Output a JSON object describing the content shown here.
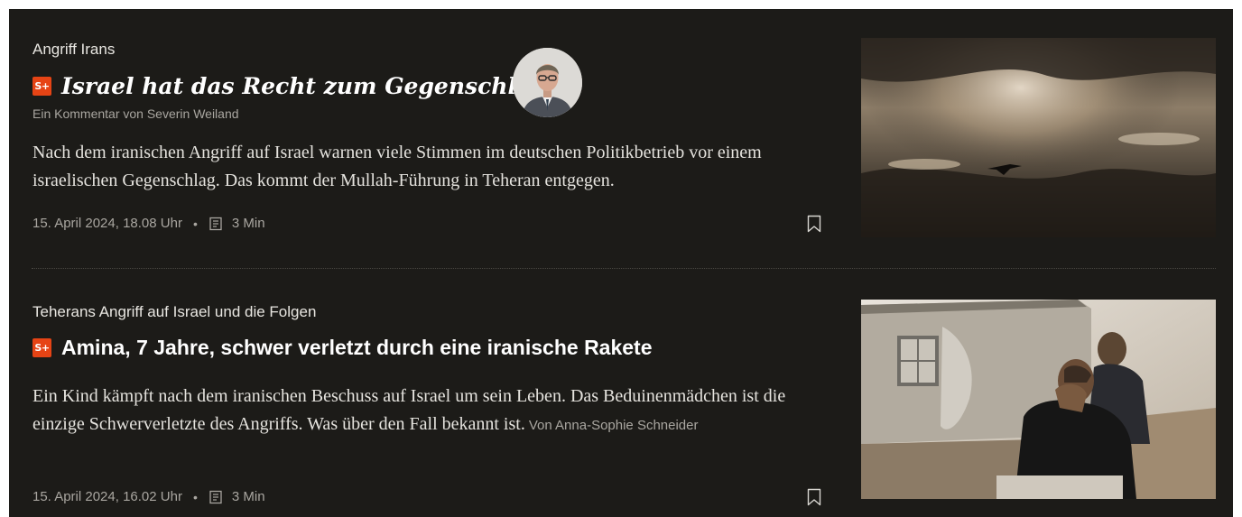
{
  "articles": [
    {
      "kicker": "Angriff Irans",
      "badge": "S+",
      "title": "Israel hat das Recht zum Gegenschlag",
      "byline": "Ein Kommentar von Severin Weiland",
      "teaser": "Nach dem iranischen Angriff auf Israel warnen viele Stimmen im deutschen Politikbetrieb vor einem israelischen Gegenschlag. Das kommt der Mullah-Führung in Teheran entgegen.",
      "date": "15. April 2024, 18.08 Uhr",
      "separator": "•",
      "read_time": "3 Min",
      "icons": {
        "badge": "spiegel-plus-icon",
        "read_time": "document-icon",
        "bookmark": "bookmark-icon"
      }
    },
    {
      "kicker": "Teherans Angriff auf Israel und die Folgen",
      "badge": "S+",
      "title": "Amina, 7 Jahre, schwer verletzt durch eine iranische Rakete",
      "teaser": "Ein Kind kämpft nach dem iranischen Beschuss auf Israel um sein Leben. Das Beduinenmädchen ist die einzige Schwerverletzte des Angriffs. Was über den Fall bekannt ist.",
      "author": "Von Anna-Sophie Schneider",
      "date": "15. April 2024, 16.02 Uhr",
      "separator": "•",
      "read_time": "3 Min",
      "icons": {
        "badge": "spiegel-plus-icon",
        "read_time": "document-icon",
        "bookmark": "bookmark-icon"
      }
    }
  ],
  "colors": {
    "background": "#1c1b18",
    "badge": "#e64415",
    "headline": "#ffffff",
    "meta": "#a9a6a0"
  }
}
